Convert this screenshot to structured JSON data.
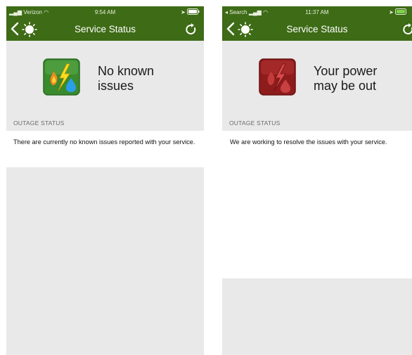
{
  "screens": [
    {
      "status_bar": {
        "carrier": "Verizon",
        "time": "9:54 AM"
      },
      "nav": {
        "title": "Service Status"
      },
      "status": {
        "message": "No known\nissues",
        "icon": "utility-status-ok-icon",
        "icon_color": "#3a8a2e"
      },
      "section_header": "OUTAGE STATUS",
      "detail": "There are currently no known issues reported with your service."
    },
    {
      "status_bar": {
        "carrier": "Search",
        "time": "11:37 AM"
      },
      "nav": {
        "title": "Service Status"
      },
      "status": {
        "message": "Your power\nmay be out",
        "icon": "utility-status-outage-icon",
        "icon_color": "#8e1c1c"
      },
      "section_header": "OUTAGE STATUS",
      "detail": "We are working to resolve the issues with your service."
    }
  ],
  "colors": {
    "nav_green": "#3e6b16",
    "panel_gray": "#e9e9e9"
  }
}
